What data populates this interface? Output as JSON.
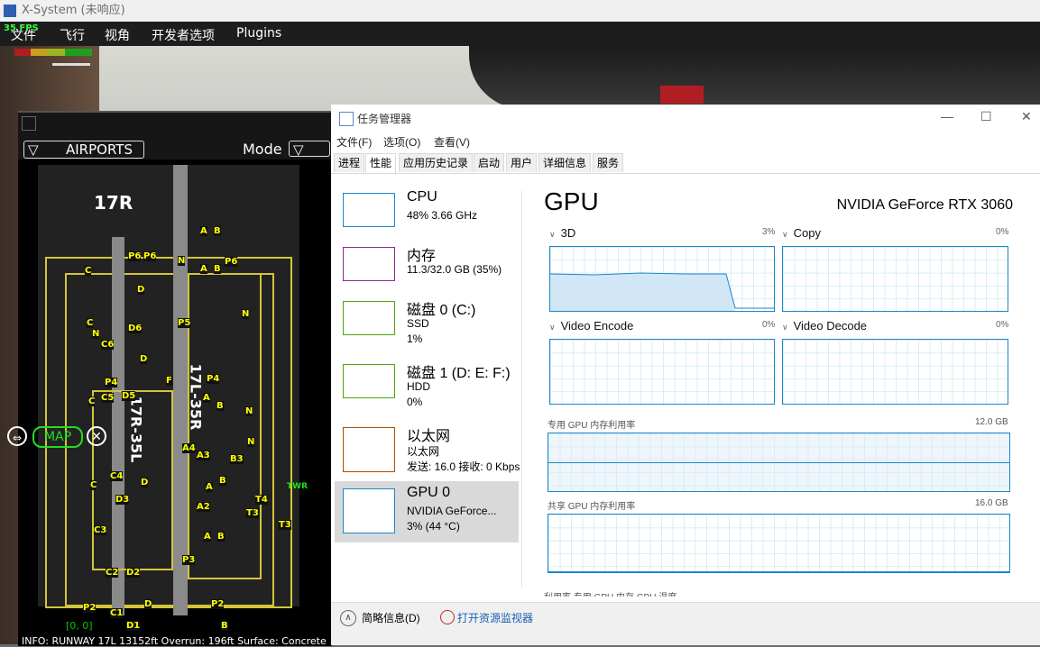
{
  "xsystem": {
    "title": "X-System (未响应)",
    "fps": "35 FPS",
    "menu": [
      "文件",
      "飞行",
      "视角",
      "开发者选项",
      "Plugins"
    ]
  },
  "map": {
    "airports_label": "AIRPORTS",
    "mode_label": "Mode",
    "map_button": "MAP",
    "coord": "[0, 0]",
    "info": "INFO: RUNWAY 17L 13152ft Overrun: 196ft Surface: Concrete",
    "twr": "TWR",
    "runways": [
      "17R",
      "17R-35L",
      "17L-35R"
    ],
    "taxi_labels": [
      "P6",
      "P6",
      "P6",
      "A",
      "B",
      "A",
      "B",
      "N",
      "C",
      "D",
      "C",
      "P5",
      "N",
      "C6",
      "D6",
      "N",
      "D",
      "F",
      "P4",
      "P4",
      "C",
      "C5",
      "D5",
      "A",
      "B",
      "N",
      "N",
      "A4",
      "A3",
      "B3",
      "C",
      "C4",
      "D",
      "A",
      "B",
      "D3",
      "T4",
      "T3",
      "A2",
      "T3",
      "C3",
      "A",
      "B",
      "P3",
      "C2",
      "D2",
      "P2",
      "C1",
      "D",
      "P2",
      "D1",
      "B"
    ]
  },
  "taskmgr": {
    "title": "任务管理器",
    "menu": [
      "文件(F)",
      "选项(O)",
      "查看(V)"
    ],
    "tabs": [
      "进程",
      "性能",
      "应用历史记录",
      "启动",
      "用户",
      "详细信息",
      "服务"
    ],
    "selected_tab": "性能",
    "sidebar": [
      {
        "name": "CPU",
        "line1": "48%  3.66 GHz",
        "line2": "",
        "color": "#1c86c7"
      },
      {
        "name": "内存",
        "line1": "11.3/32.0 GB (35%)",
        "line2": "",
        "color": "#8b2596"
      },
      {
        "name": "磁盘 0 (C:)",
        "line1": "SSD",
        "line2": "1%",
        "color": "#4da60c"
      },
      {
        "name": "磁盘 1 (D: E: F:)",
        "line1": "HDD",
        "line2": "0%",
        "color": "#4da60c"
      },
      {
        "name": "以太网",
        "line1": "以太网",
        "line2": "发送: 16.0  接收: 0 Kbps",
        "color": "#a74f01"
      },
      {
        "name": "GPU 0",
        "line1": "NVIDIA GeForce...",
        "line2": "3%  (44 °C)",
        "color": "#1c86c7"
      }
    ],
    "gpu": {
      "heading": "GPU",
      "model": "NVIDIA GeForce RTX 3060",
      "engines": [
        {
          "label": "3D",
          "pct": "3%"
        },
        {
          "label": "Copy",
          "pct": "0%"
        },
        {
          "label": "Video Encode",
          "pct": "0%"
        },
        {
          "label": "Video Decode",
          "pct": "0%"
        }
      ],
      "dedicated_label": "专用 GPU 内存利用率",
      "dedicated_max": "12.0 GB",
      "shared_label": "共享 GPU 内存利用率",
      "shared_max": "16.0 GB",
      "cutoff_row": "利用率                    专用 GPU 内存                   GPU 温度"
    },
    "bottom": {
      "fewer": "简略信息(D)",
      "resmon": "打开资源监视器"
    }
  }
}
